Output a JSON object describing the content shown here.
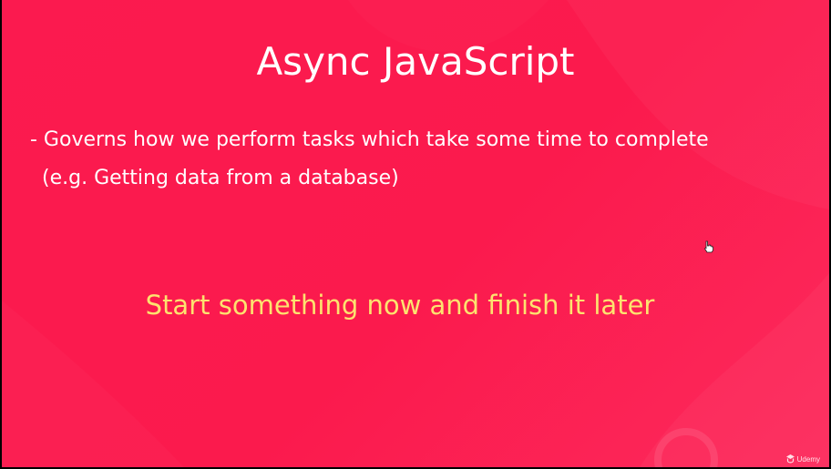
{
  "slide": {
    "title": "Async JavaScript",
    "bullet_line_1": "- Governs how we perform tasks which take some time to complete",
    "bullet_line_2": "(e.g. Getting data from a database)",
    "highlight": "Start something now and finish it later",
    "watermark": "Udemy"
  },
  "colors": {
    "background": "#fb1a4f",
    "title_text": "#ffffff",
    "highlight_text": "#fde36f"
  },
  "icons": {
    "cursor": "hand-pointer-icon",
    "watermark": "udemy-logo-icon"
  }
}
